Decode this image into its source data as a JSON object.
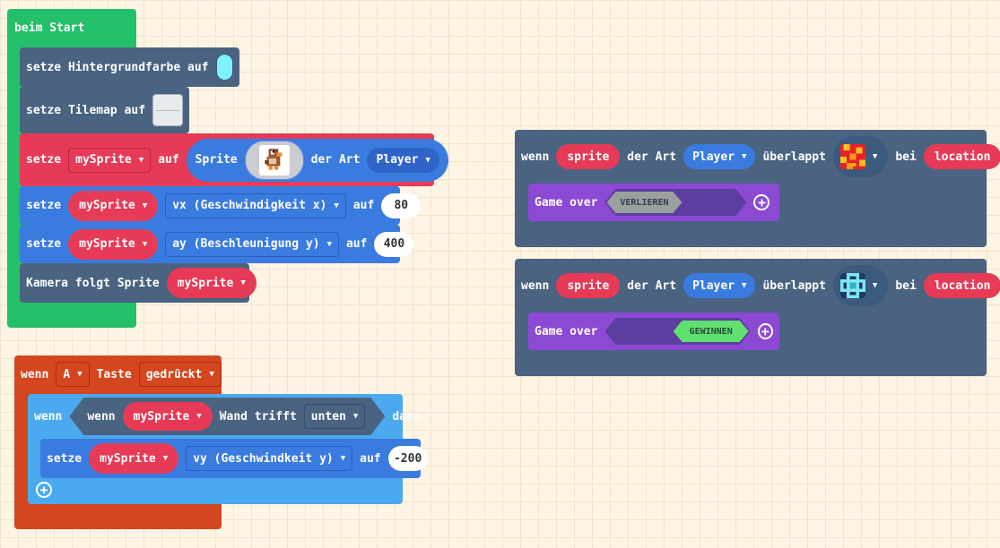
{
  "on_start": {
    "header": "beim Start",
    "bg_row": {
      "label": "setze Hintergrundfarbe auf",
      "color": "#7ff0ff"
    },
    "tilemap_row": {
      "label": "setze Tilemap auf"
    },
    "sprite_row": {
      "set": "setze",
      "var": "mySprite",
      "to": "auf",
      "sprite_label": "Sprite",
      "kind_label": "der Art",
      "kind": "Player"
    },
    "vx_row": {
      "set": "setze",
      "var": "mySprite",
      "prop": "vx (Geschwindigkeit x)",
      "to": "auf",
      "value": "80"
    },
    "ay_row": {
      "set": "setze",
      "var": "mySprite",
      "prop": "ay (Beschleunigung y)",
      "to": "auf",
      "value": "400"
    },
    "camera_row": {
      "label": "Kamera folgt Sprite",
      "var": "mySprite"
    }
  },
  "button_event": {
    "when": "wenn",
    "button": "A",
    "key_label": "Taste",
    "state": "gedrückt",
    "if_label": "wenn",
    "then_label": "dann",
    "condition": {
      "when": "wenn",
      "var": "mySprite",
      "hits": "Wand trifft",
      "side": "unten"
    },
    "set_row": {
      "set": "setze",
      "var": "mySprite",
      "prop": "vy (Geschwindkeit y)",
      "to": "auf",
      "value": "-200"
    }
  },
  "overlap_events": [
    {
      "when": "wenn",
      "sprite": "sprite",
      "kind_label": "der Art",
      "kind": "Player",
      "overlaps": "überlappt",
      "at": "bei",
      "location": "location",
      "tile_icon": "lava-tile",
      "game_over": "Game over",
      "result": "VERLIEREN",
      "result_color": "#9aa09d"
    },
    {
      "when": "wenn",
      "sprite": "sprite",
      "kind_label": "der Art",
      "kind": "Player",
      "overlaps": "überlappt",
      "at": "bei",
      "location": "location",
      "tile_icon": "cyan-diamond-tile",
      "game_over": "Game over",
      "result": "GEWINNEN",
      "result_color": "#5fe06f"
    }
  ],
  "colors": {
    "events": "#23bf6a",
    "scene": "#4a6381",
    "sprites": "#e63a57",
    "logic": "#3a7be0",
    "controller": "#d4461f",
    "if_block": "#4aa9ef",
    "game": "#8b49d4",
    "dark_input": "#3c5a7d"
  }
}
